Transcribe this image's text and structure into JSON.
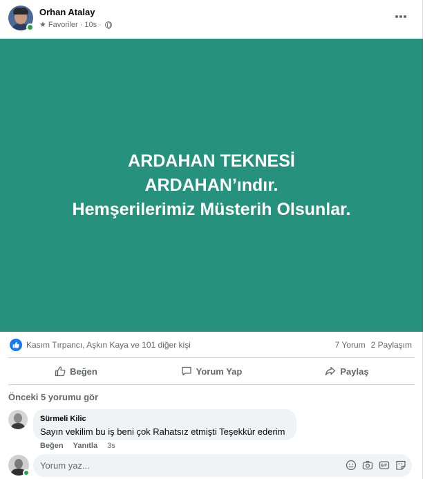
{
  "post": {
    "author": "Orhan Atalay",
    "audience": "Favoriler",
    "time": "10s",
    "separator": "·",
    "media_lines": [
      "ARDAHAN TEKNESİ",
      "ARDAHAN’ındır.",
      "Hemşerilerimiz Müsterih Olsunlar."
    ],
    "media_color": "#26927e"
  },
  "reactions": {
    "names": "Kasım Tırpancı, Aşkın Kaya ve 101 diğer kişi",
    "comments": "7 Yorum",
    "shares": "2 Paylaşım"
  },
  "actions": {
    "like": "Beğen",
    "comment": "Yorum Yap",
    "share": "Paylaş"
  },
  "comments": {
    "previous_label": "Önceki 5 yorumu gör",
    "items": [
      {
        "author": "Sürmeli Kilic",
        "text": "Sayın vekilim bu iş beni çok Rahatsız etmişti Teşekkür ederim",
        "like": "Beğen",
        "reply": "Yanıtla",
        "time": "3s"
      }
    ],
    "input_placeholder": "Yorum yaz..."
  },
  "colors": {
    "brand": "#1877f2",
    "online": "#31a24c",
    "secondary_text": "#65676b"
  }
}
